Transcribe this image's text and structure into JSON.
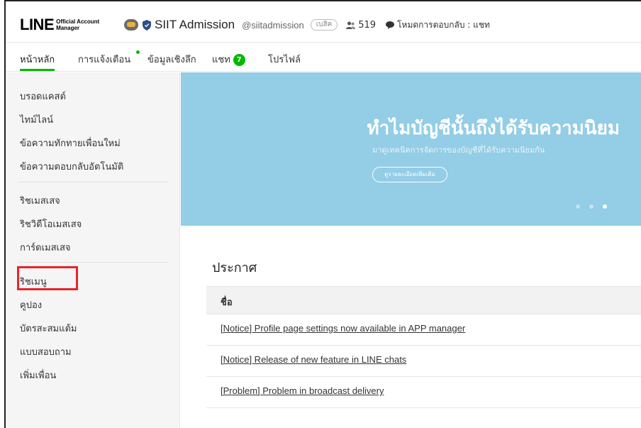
{
  "header": {
    "logo_text": "LINE",
    "logo_sub_line1": "Official Account",
    "logo_sub_line2": "Manager",
    "account_name": "SIIT Admission",
    "account_id": "@siitadmission",
    "badge": "เบสิค",
    "friends_count": "519",
    "response_mode": "โหมดการตอบกลับ : แชท"
  },
  "tabs": [
    {
      "label": "หน้าหลัก",
      "active": true
    },
    {
      "label": "การแจ้งเตือน"
    },
    {
      "label": "ข้อมูลเชิงลึก"
    },
    {
      "label": "แชท",
      "count": "7"
    },
    {
      "label": "โปรไฟล์"
    }
  ],
  "sidebar": {
    "group1": [
      "บรอดแคสต์",
      "ไทม์ไลน์",
      "ข้อความทักทายเพื่อนใหม่",
      "ข้อความตอบกลับอัตโนมัติ"
    ],
    "group2": [
      "ริชเมสเสจ",
      "ริชวิดีโอเมสเสจ",
      "การ์ดเมสเสจ"
    ],
    "group3": [
      "ริชเมนู",
      "คูปอง",
      "บัตรสะสมแต้ม",
      "แบบสอบถาม",
      "เพิ่มเพื่อน"
    ]
  },
  "banner": {
    "title": "ทำไมบัญชีนั้นถึงได้รับความนิยม",
    "subtitle": "มาดูเทคนิคการจัดการของบัญชีที่ได้รับความนิยมกัน",
    "button": "ดูรายละเอียดเพิ่มเติม"
  },
  "announcements": {
    "title": "ประกาศ",
    "column_header": "ชื่อ",
    "items": [
      "[Notice] Profile page settings now available in APP manager",
      "[Notice] Release of new feature in LINE chats",
      "[Problem] Problem in broadcast delivery"
    ]
  },
  "colors": {
    "accent": "#00b900",
    "banner": "#93cde6",
    "highlight": "#e8242a"
  }
}
